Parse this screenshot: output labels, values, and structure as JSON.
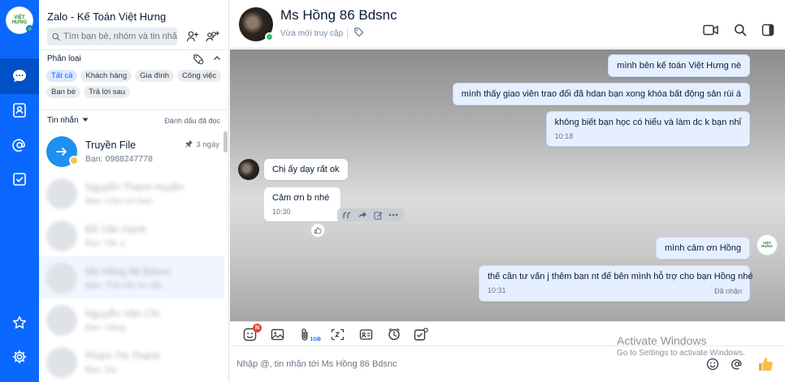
{
  "app": {
    "title": "Zalo - Kế Toán Việt Hưng",
    "brand_color": "#0A68FF",
    "logo_text": "VIỆT HƯNG"
  },
  "rail": {
    "items": [
      {
        "name": "messages",
        "icon": "chat-bubble-icon",
        "active": true
      },
      {
        "name": "contacts",
        "icon": "contact-book-icon",
        "active": false
      },
      {
        "name": "mentions",
        "icon": "at-sign-icon",
        "active": false
      },
      {
        "name": "todo",
        "icon": "checkbox-icon",
        "active": false
      },
      {
        "name": "favorites",
        "icon": "star-icon",
        "active": false
      },
      {
        "name": "settings",
        "icon": "gear-icon",
        "active": false
      }
    ]
  },
  "search": {
    "placeholder": "Tìm bạn bè, nhóm và tin nhắn"
  },
  "categories": {
    "label": "Phân loại",
    "chips": [
      "Tất cả",
      "Khách hàng",
      "Gia đình",
      "Công việc",
      "Bạn bè",
      "Trả lời sau"
    ],
    "active_index": 0
  },
  "messages_section": {
    "label": "Tin nhắn",
    "mark_read": "Đánh dấu đã đọc"
  },
  "conversations": [
    {
      "name": "Truyền File",
      "preview": "Bạn: 0988247778",
      "time": "3 ngày",
      "pinned": true
    },
    {
      "name": "Nguyễn Thanh Huyền",
      "preview": "Bạn: Cảm ơn bạn",
      "time": ""
    },
    {
      "name": "Đỗ Văn Hạnh",
      "preview": "Bạn: OK ạ",
      "time": ""
    },
    {
      "name": "Ms Hồng 86 Bdsnc",
      "preview": "Bạn: Thế cần tư vấn",
      "time": ""
    },
    {
      "name": "Nguyễn Văn Chi",
      "preview": "Bạn: Vâng",
      "time": ""
    },
    {
      "name": "Phạm Thị Thanh",
      "preview": "Bạn: Dạ",
      "time": ""
    }
  ],
  "chat": {
    "contact_name": "Ms Hồng 86 Bdsnc",
    "status": "Vừa mới truy cập",
    "messages": [
      {
        "from": "me",
        "text": "mình bên kế toán Việt Hưng nè"
      },
      {
        "from": "me",
        "text": "mình thấy giao viên trao đổi đã hdan bạn xong khóa bất động sản rùi á"
      },
      {
        "from": "me",
        "text": "không biết bạn học có hiểu và làm dc k bạn nhỉ",
        "time": "10:18"
      },
      {
        "from": "them",
        "text": "Chị ấy dạy rất ok"
      },
      {
        "from": "them",
        "text": "Cảm ơn b nhé",
        "time": "10:30"
      },
      {
        "from": "me",
        "text": "mình cảm ơn Hồng"
      },
      {
        "from": "me",
        "text": "thế cần tư vấn j thêm bạn nt để bên mình hỗ trợ cho bạn Hồng nhé",
        "time": "10:31",
        "state": "Đã nhận"
      }
    ]
  },
  "toolbar": {
    "sticker_badge": "N",
    "file_size_label": "1GB",
    "tools": [
      "sticker-icon",
      "image-icon",
      "attach-icon",
      "screenshot-icon",
      "contact-card-icon",
      "reminder-icon",
      "task-icon"
    ]
  },
  "composer": {
    "placeholder": "Nhập @, tin nhắn tới Ms Hồng 86 Bdsnc"
  },
  "watermark": {
    "line1": "Activate Windows",
    "line2": "Go to Settings to activate Windows."
  }
}
